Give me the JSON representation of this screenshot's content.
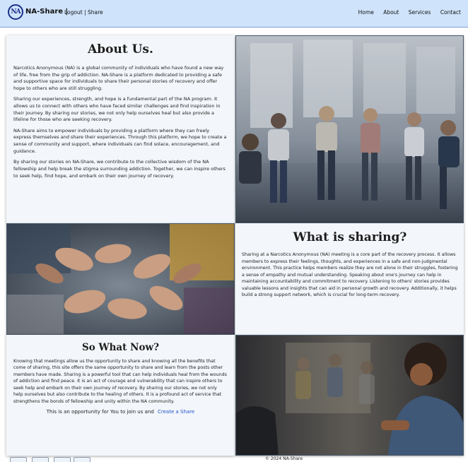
{
  "header": {
    "brand": "NA-Share |",
    "logo_text": "NA",
    "user_links": {
      "logout": "Logout",
      "separator": " | ",
      "share": "Share"
    },
    "nav": [
      {
        "label": "Home"
      },
      {
        "label": "About"
      },
      {
        "label": "Services"
      },
      {
        "label": "Contact"
      }
    ]
  },
  "about": {
    "title": "About Us.",
    "paragraphs": [
      "Narcotics Anonymous (NA) is a global community of individuals who have found a new way of life, free from the grip of addiction. NA-Share is a platform dedicated to providing a safe and supportive space for individuals to share their personal stories of recovery and offer hope to others who are still struggling.",
      "Sharing our experiences, strength, and hope is a fundamental part of the NA program. It allows us to connect with others who have faced similar challenges and find inspiration in their journey. By sharing our stories, we not only help ourselves heal but also provide a lifeline for those who are seeking recovery.",
      "NA-Share aims to empower individuals by providing a platform where they can freely express themselves and share their experiences. Through this platform, we hope to create a sense of community and support, where individuals can find solace, encouragement, and guidance.",
      "By sharing our stories on NA-Share, we contribute to the collective wisdom of the NA fellowship and help break the stigma surrounding addiction. Together, we can inspire others to seek help, find hope, and embark on their own journey of recovery."
    ]
  },
  "sharing": {
    "title": "What is sharing?",
    "paragraph": "Sharing at a Narcotics Anonymous (NA) meeting is a core part of the recovery process. It allows members to express their feelings, thoughts, and experiences in a safe and non-judgmental environment. This practice helps members realize they are not alone in their struggles, fostering a sense of empathy and mutual understanding. Speaking about one's journey can help in maintaining accountability and commitment to recovery. Listening to others' stories provides valuable lessons and insights that can aid in personal growth and recovery. Additionally, it helps build a strong support network, which is crucial for long-term recovery."
  },
  "sowhat": {
    "title": "So What Now?",
    "paragraph": "Knowing that meetings allow us the opportunity to share and knowing all the benefits that come of sharing, this site offers the same opportunity to share and learn from the posts other members have made. Sharing is a powerful tool that can help individuals heal from the wounds of addiction and find peace. It is an act of courage and vulnerability that can inspire others to seek help and embark on their own journey of recovery. By sharing our stories, we not only help ourselves but also contribute to the healing of others. It is a profound act of service that strengthens the bonds of fellowship and unity within the NA community.",
    "cta_text": "This is an opportunity for You to join us and",
    "cta_link": "Create a Share"
  },
  "footer": {
    "copyright": "© 2024 NA-Share"
  },
  "colors": {
    "header_bg": "#cfe3fb",
    "link": "#2255cc",
    "panel_bg": "#f3f6fa"
  }
}
